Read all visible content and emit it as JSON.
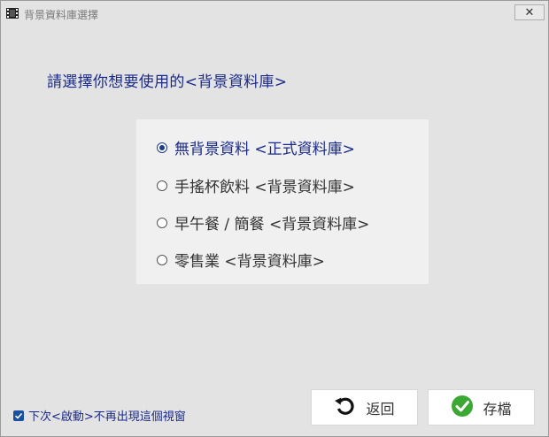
{
  "window": {
    "title": "背景資料庫選擇",
    "close_label": "✕"
  },
  "prompt": "請選擇你想要使用的<背景資料庫>",
  "options": [
    {
      "label": "無背景資料 <正式資料庫>",
      "selected": true
    },
    {
      "label": "手搖杯飲料 <背景資料庫>",
      "selected": false
    },
    {
      "label": "早午餐 / 簡餐 <背景資料庫>",
      "selected": false
    },
    {
      "label": "零售業 <背景資料庫>",
      "selected": false
    }
  ],
  "footer": {
    "dont_show_label": "下次<啟動>不再出現這個視窗",
    "dont_show_checked": true,
    "back_label": "返回",
    "save_label": "存檔"
  },
  "colors": {
    "accent": "#1a2a8a",
    "save_icon": "#3aa832"
  }
}
